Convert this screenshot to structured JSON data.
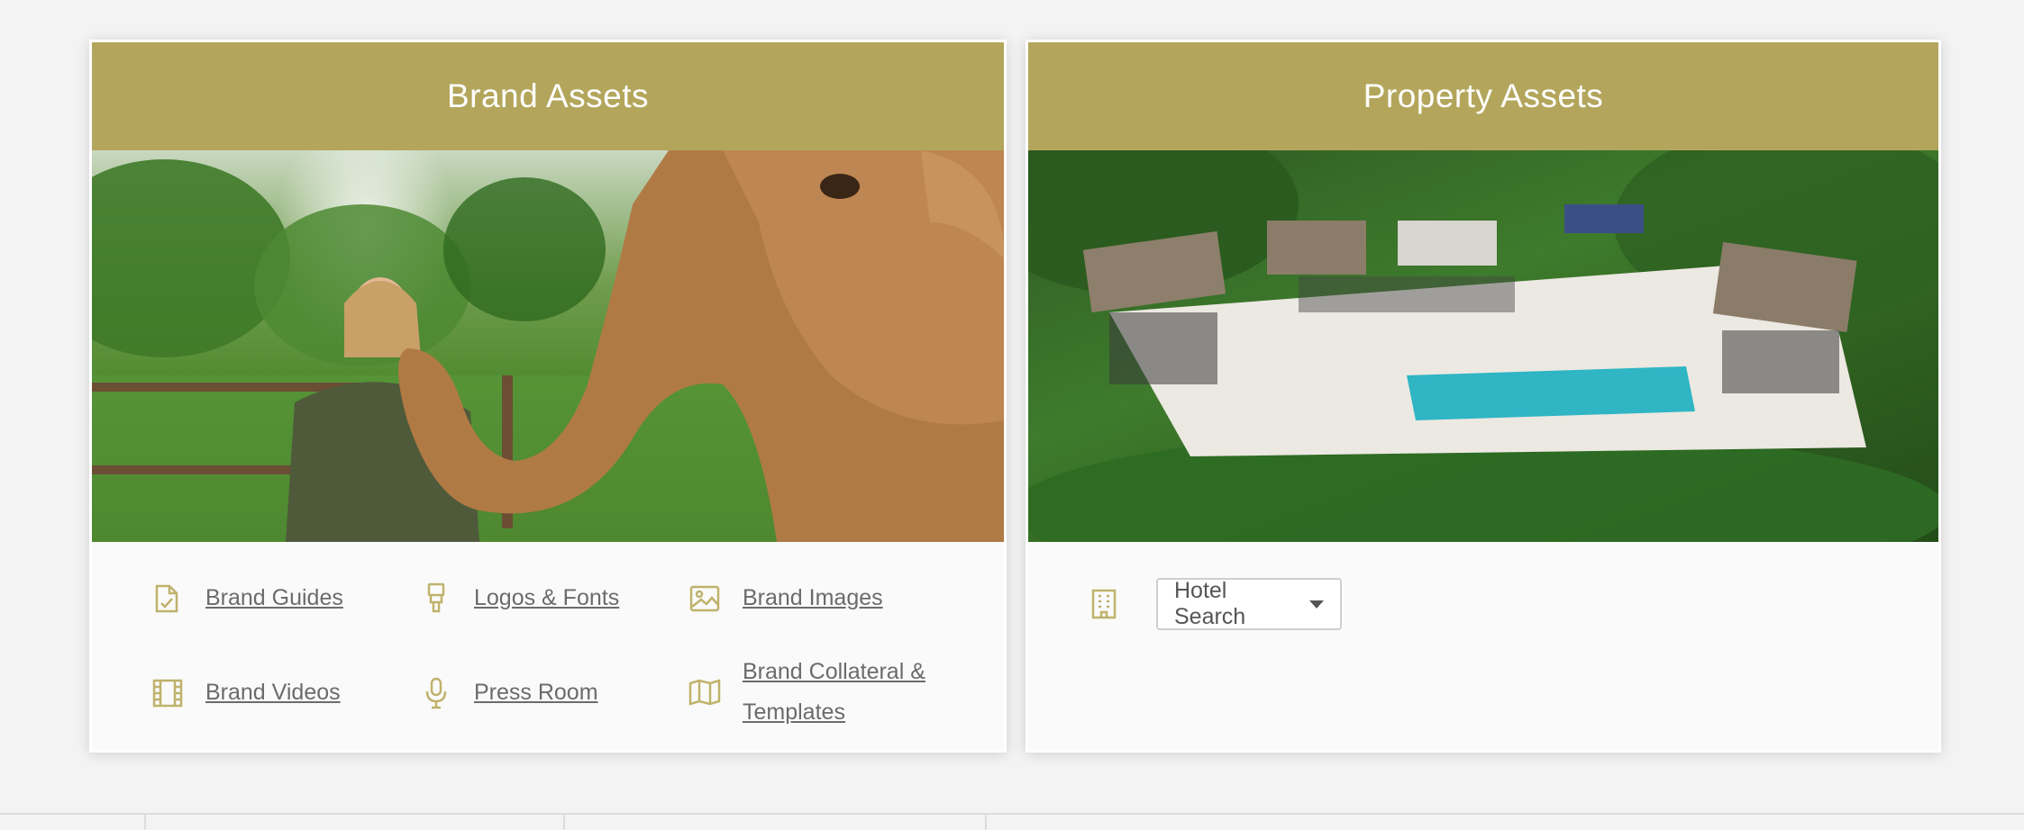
{
  "brand_card": {
    "title": "Brand Assets",
    "links": [
      {
        "label": "Brand Guides",
        "icon": "document-check-icon"
      },
      {
        "label": "Logos & Fonts",
        "icon": "marker-icon"
      },
      {
        "label": "Brand Images",
        "icon": "image-icon"
      },
      {
        "label": "Brand Videos",
        "icon": "film-icon"
      },
      {
        "label": "Press Room",
        "icon": "microphone-icon"
      },
      {
        "label": "Brand Collateral & Templates",
        "icon": "map-icon"
      }
    ]
  },
  "property_card": {
    "title": "Property Assets",
    "hotel_search": {
      "label": "Hotel Search",
      "icon": "building-icon"
    }
  },
  "colors": {
    "header": "#b3a65c",
    "icon": "#bfb26b",
    "link": "#6b6b6b"
  }
}
